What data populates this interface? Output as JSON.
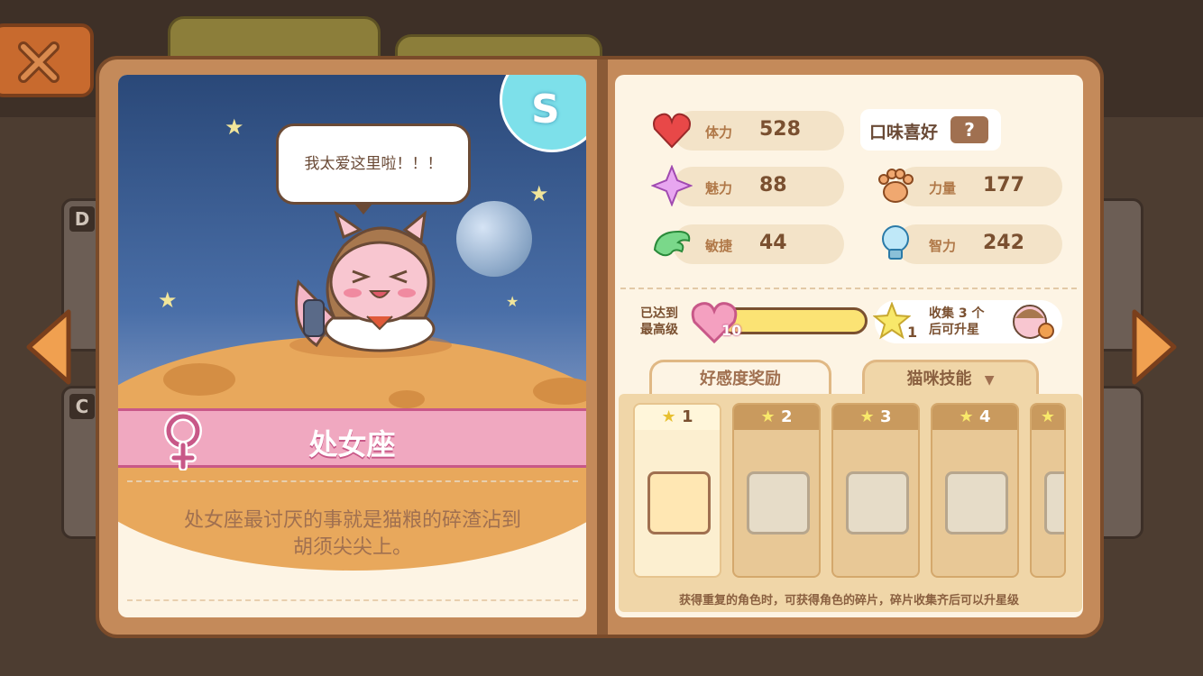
{
  "character": {
    "speech": "我太爱这里啦！！！",
    "rarity_badge": "S",
    "constellation": "处女座",
    "description_line1": "处女座最讨厌的事就是猫粮的碎渣沾到",
    "description_line2": "胡须尖尖上。"
  },
  "side_cards": [
    {
      "grade": "D"
    },
    {
      "grade": "C"
    }
  ],
  "stats": {
    "stamina": {
      "label": "体力",
      "value": "528"
    },
    "charm": {
      "label": "魅力",
      "value": "88"
    },
    "strength": {
      "label": "力量",
      "value": "177"
    },
    "agility": {
      "label": "敏捷",
      "value": "44"
    },
    "intelligence": {
      "label": "智力",
      "value": "242"
    }
  },
  "taste": {
    "label": "口味喜好",
    "value": "?"
  },
  "level": {
    "status_line1": "已达到",
    "status_line2": "最高级",
    "heart_level": "10",
    "fill": 1.0
  },
  "star_collect": {
    "count": "1",
    "text_line1": "收集 3 个",
    "text_line2": "后可升星"
  },
  "tabs": [
    {
      "label": "好感度奖励"
    },
    {
      "label": "猫咪技能"
    }
  ],
  "skill_levels": [
    "1",
    "2",
    "3",
    "4"
  ],
  "footer_note": "获得重复的角色时，可获得角色的碎片，碎片收集齐后可以升星级",
  "colors": {
    "accent_pink": "#f0a8c0",
    "panel": "#fdf4e4",
    "frame": "#c48a5a"
  }
}
